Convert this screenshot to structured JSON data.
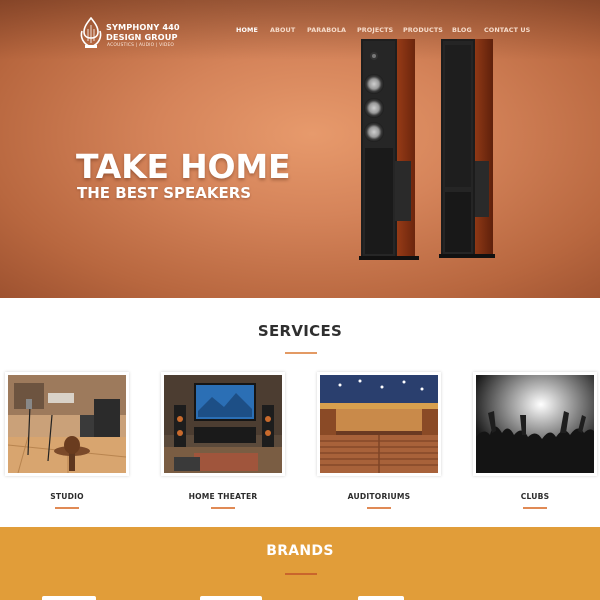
{
  "brand": {
    "name_line1": "SYMPHONY 440",
    "name_line2": "DESIGN GROUP",
    "tagline": "ACOUSTICS | AUDIO | VIDEO",
    "logo_icon": "harp-icon"
  },
  "nav": {
    "items": [
      {
        "label": "HOME",
        "active": true
      },
      {
        "label": "ABOUT",
        "active": false
      },
      {
        "label": "PARABOLA",
        "active": false
      },
      {
        "label": "PROJECTS",
        "active": false
      },
      {
        "label": "PRODUCTS",
        "active": false
      },
      {
        "label": "BLOG",
        "active": false
      },
      {
        "label": "CONTACT US",
        "active": false
      }
    ]
  },
  "hero": {
    "title": "TAKE HOME",
    "subtitle": "THE BEST SPEAKERS",
    "image": "floor-standing-speakers"
  },
  "services": {
    "title": "SERVICES",
    "items": [
      {
        "label": "STUDIO",
        "image": "studio-photo"
      },
      {
        "label": "HOME THEATER",
        "image": "home-theater-photo"
      },
      {
        "label": "AUDITORIUMS",
        "image": "auditorium-photo"
      },
      {
        "label": "CLUBS",
        "image": "club-photo"
      }
    ]
  },
  "brands": {
    "title": "BRANDS"
  },
  "colors": {
    "hero_bg": "#d5845a",
    "accent_rule": "#e39a64",
    "brands_bg": "#e19d39",
    "heading_text": "#2f2f2f"
  }
}
